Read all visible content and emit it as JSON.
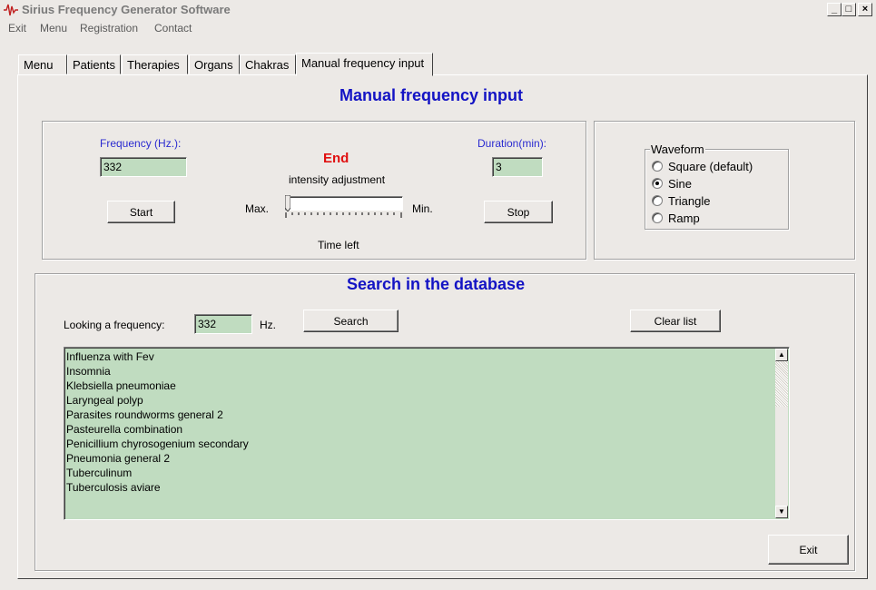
{
  "window": {
    "title": "Sirius Frequency Generator Software",
    "minimize": "_",
    "maximize": "□",
    "close": "×"
  },
  "menubar": {
    "items": [
      "Exit",
      "Menu",
      "Registration",
      "Contact"
    ]
  },
  "tabs": [
    "Menu",
    "Patients",
    "Therapies",
    "Organs",
    "Chakras",
    "Manual frequency input"
  ],
  "active_tab": "Manual frequency input",
  "manual": {
    "heading": "Manual frequency input",
    "frequency_label": "Frequency (Hz.):",
    "frequency_value": "332",
    "start_button": "Start",
    "status": "End",
    "intensity_label": "intensity adjustment",
    "max_label": "Max.",
    "min_label": "Min.",
    "time_left_label": "Time left",
    "duration_label": "Duration(min):",
    "duration_value": "3",
    "stop_button": "Stop",
    "intensity_level": 0
  },
  "waveform": {
    "legend": "Waveform",
    "options": [
      "Square (default)",
      "Sine",
      "Triangle",
      "Ramp"
    ],
    "selected": "Sine"
  },
  "search": {
    "heading": "Search in the database",
    "looking_label": "Looking a frequency:",
    "frequency_value": "332",
    "unit": "Hz.",
    "search_button": "Search",
    "clear_button": "Clear list",
    "results": [
      "Influenza with Fev",
      "Insomnia",
      "Klebsiella pneumoniae",
      "Laryngeal polyp",
      "Parasites roundworms general 2",
      "Pasteurella combination",
      "Penicillium chyrosogenium secondary",
      "Pneumonia general 2",
      "Tuberculinum",
      "Tuberculosis aviare"
    ]
  },
  "exit_button": "Exit",
  "colors": {
    "heading": "#1313c4",
    "status": "#e01010",
    "field_bg": "#c0dcc0",
    "window_bg": "#ece9e6"
  }
}
